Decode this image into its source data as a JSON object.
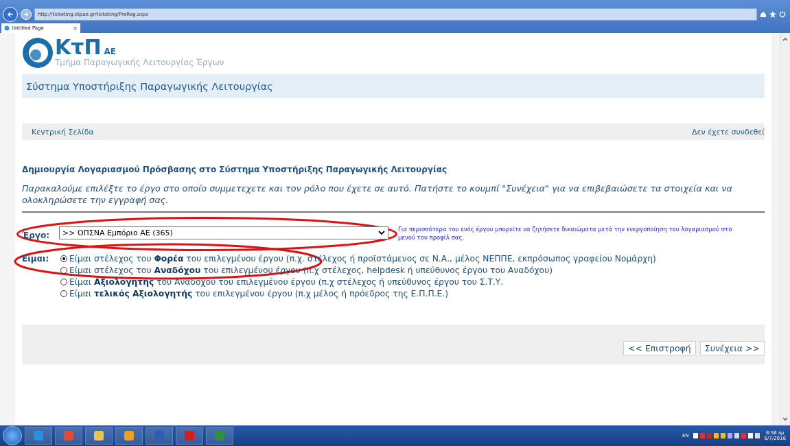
{
  "browser": {
    "url": "http://ticketing.ktpae.gr/ticketing/PreReg.aspx",
    "tabs": [
      {
        "label": "Untitled Page",
        "selected": true,
        "close": "×"
      }
    ]
  },
  "logo": {
    "name": "ΚτΠ",
    "suffix": "ΑΕ",
    "tagline": "Τμήμα Παραγωγικής Λειτουργίας Έργων"
  },
  "header": {
    "title": "Σύστημα Υποστήριξης Παραγωγικής Λειτουργίας"
  },
  "nav": {
    "home": "Κεντρική Σελίδα",
    "login_status": "Δεν έχετε συνδεθεί"
  },
  "form": {
    "heading": "Δημιουργία Λογαριασμού Πρόσβασης στο Σύστημα Υποστήριξης Παραγωγικής Λειτουργίας",
    "intro": "Παρακαλούμε επιλέξτε το έργο στο οποίο συμμετεχετε και τον ρόλο που έχετε σε αυτό. Πατήστε το κουμπί \"Συνέχεια\" για να επιβεβαιώσετε τα στοιχεία και να ολοκληρώσετε την εγγραφή σας.",
    "project": {
      "label": "Έργο:",
      "value": ">> ΟΠΣΝΑ Εμπόριο ΑΕ (365)",
      "highlighted": true,
      "note": "Για περισσότερα του ενός έργου μπορείτε να ζητήσετε δικαιώματα μετά την ενεργοποίηση του λογαριασμού στο μενού του προφίλ σας."
    },
    "role": {
      "label": "Είμαι:",
      "highlighted": true,
      "options": [
        {
          "text": "Είμαι στέλεχος του **Φορέα** του επιλεγμένου έργου (π.χ. στέλεχος ή προϊστάμενος σε Ν.Α., μέλος ΝΕΠΠΕ, εκπρόσωπος γραφείου Νομάρχη)",
          "selected": true
        },
        {
          "text": "Είμαι στέλεχος του **Αναδόχου** του επιλεγμένου έργου (π.χ στέλεχος, helpdesk ή υπεύθυνος έργου του Αναδόχου)",
          "selected": false
        },
        {
          "text": "Είμαι **Αξιολογητής** του Αναδόχου του επιλεγμένου έργου (π.χ στέλεχος ή υπεύθυνος έργου του Σ.Τ.Υ.",
          "selected": false
        },
        {
          "text": "Είμαι **τελικός Αξιολογητής** του επιλεγμένου έργου (π.χ μέλος ή πρόεδρος της Ε.Π.Π.Ε.)",
          "selected": false
        }
      ]
    },
    "buttons": {
      "back": "<< Επιστροφή",
      "next": "Συνέχεια >>"
    }
  },
  "taskbar": {
    "apps": [
      {
        "kind": "ie"
      },
      {
        "kind": "chrome"
      },
      {
        "kind": "folder"
      },
      {
        "kind": "outlook"
      },
      {
        "kind": "word"
      },
      {
        "kind": "pdf"
      },
      {
        "kind": "excel"
      }
    ],
    "language": "EN",
    "time": "8:58 πμ",
    "date": "6/7/2016"
  }
}
